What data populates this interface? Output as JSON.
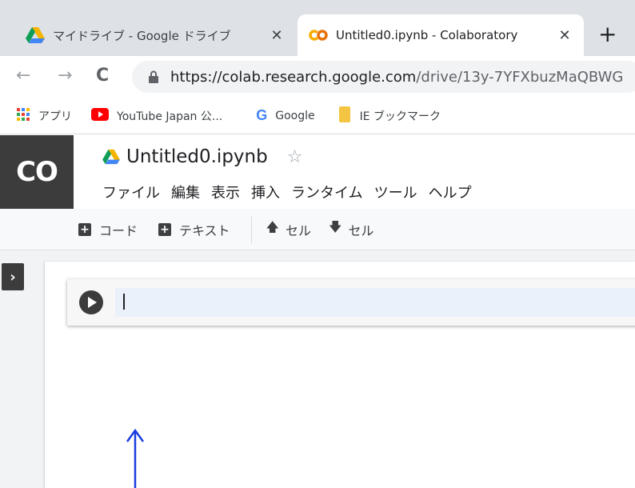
{
  "browser": {
    "tabs": [
      {
        "title": "マイドライブ - Google ドライブ",
        "active": false
      },
      {
        "title": "Untitled0.ipynb - Colaboratory",
        "active": true
      }
    ],
    "close_glyph": "✕",
    "new_tab_glyph": "+",
    "back_glyph": "←",
    "forward_glyph": "→",
    "reload_glyph": "C",
    "url_host": "https://colab.research.google.com",
    "url_path": "/drive/13y-7YFXbuzMaQBWG"
  },
  "bookmarks": [
    {
      "label": "アプリ",
      "icon": "apps-grid-icon"
    },
    {
      "label": "YouTube Japan 公...",
      "icon": "youtube-icon"
    },
    {
      "label": "Google",
      "icon": "google-icon"
    },
    {
      "label": "IE ブックマーク",
      "icon": "folder-icon"
    }
  ],
  "colab": {
    "logo_text": "CO",
    "notebook_title": "Untitled0.ipynb",
    "star_glyph": "☆",
    "menu": [
      "ファイル",
      "編集",
      "表示",
      "挿入",
      "ランタイム",
      "ツール",
      "ヘルプ"
    ],
    "toolbar": {
      "add_code": "コード",
      "add_text": "テキスト",
      "cell_up": "セル",
      "cell_down": "セル"
    },
    "sidebar_toggle_glyph": "›",
    "cell_code": ""
  },
  "colors": {
    "drive_green": "#0f9d58",
    "drive_yellow": "#f4b400",
    "drive_blue": "#4285f4",
    "colab_orange": "#f9ab00",
    "annotation_blue": "#1a3ce0"
  }
}
